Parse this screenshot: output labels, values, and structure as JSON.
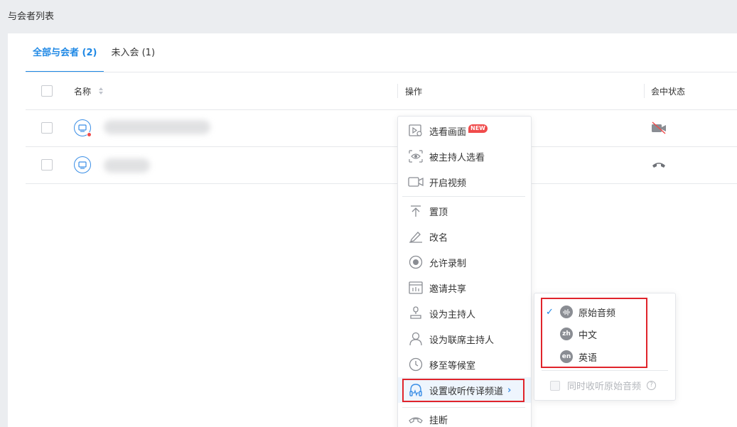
{
  "page": {
    "title": "与会者列表"
  },
  "tabs": [
    {
      "label": "全部与会者 (2)",
      "active": true
    },
    {
      "label": "未入会 (1)",
      "active": false
    }
  ],
  "table": {
    "columns": {
      "name": "名称",
      "action": "操作",
      "status": "会中状态"
    },
    "rows": [
      {
        "avatar": "screen-icon",
        "badge": "red-dot",
        "status_icon": "video-off-icon"
      },
      {
        "avatar": "screen-icon",
        "badge": null,
        "status_icon": "hangup-icon"
      }
    ]
  },
  "menu": {
    "items": [
      {
        "label": "选看画面",
        "icon": "select-view-icon",
        "badge": "NEW"
      },
      {
        "label": "被主持人选看",
        "icon": "eye-icon"
      },
      {
        "label": "开启视频",
        "icon": "video-icon"
      },
      {
        "label": "置顶",
        "icon": "pin-top-icon"
      },
      {
        "label": "改名",
        "icon": "pencil-icon"
      },
      {
        "label": "允许录制",
        "icon": "record-icon"
      },
      {
        "label": "邀请共享",
        "icon": "share-icon"
      },
      {
        "label": "设为主持人",
        "icon": "host-icon"
      },
      {
        "label": "设为联席主持人",
        "icon": "cohost-icon"
      },
      {
        "label": "移至等候室",
        "icon": "clock-icon"
      },
      {
        "label": "设置收听传译频道",
        "icon": "headphone-icon",
        "highlighted": true
      },
      {
        "label": "挂断",
        "icon": "hangup-icon"
      }
    ]
  },
  "submenu": {
    "languages": [
      {
        "label": "原始音频",
        "code": "",
        "icon": "waveform-icon",
        "selected": true
      },
      {
        "label": "中文",
        "code": "zh",
        "selected": false
      },
      {
        "label": "英语",
        "code": "en",
        "selected": false
      }
    ],
    "option_label": "同时收听原始音频",
    "option_help": "?"
  },
  "colors": {
    "accent": "#1e88e5",
    "highlight_border": "#e0242b",
    "badge": "#f04b4b"
  }
}
